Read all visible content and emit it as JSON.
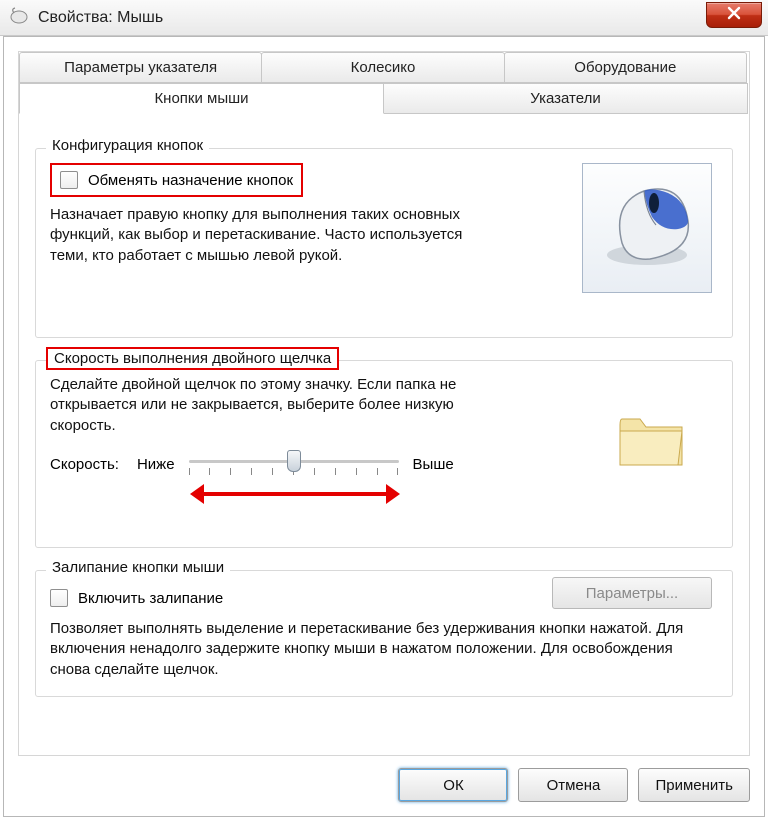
{
  "titlebar": {
    "title": "Свойства: Мышь"
  },
  "tabs": {
    "row1": [
      {
        "label": "Параметры указателя"
      },
      {
        "label": "Колесико"
      },
      {
        "label": "Оборудование"
      }
    ],
    "row2": [
      {
        "label": "Кнопки мыши",
        "active": true
      },
      {
        "label": "Указатели"
      }
    ]
  },
  "group_buttons": {
    "legend": "Конфигурация кнопок",
    "swap_label": "Обменять назначение кнопок",
    "desc": "Назначает правую кнопку для выполнения таких основных функций, как выбор и перетаскивание. Часто используется теми, кто работает с мышью левой рукой."
  },
  "group_dblclick": {
    "legend": "Скорость выполнения двойного щелчка",
    "desc": "Сделайте двойной щелчок по этому значку. Если папка не открывается или не закрывается, выберите более низкую скорость.",
    "speed_label": "Скорость:",
    "low_label": "Ниже",
    "high_label": "Выше"
  },
  "group_clicklock": {
    "legend": "Залипание кнопки мыши",
    "enable_label": "Включить залипание",
    "params_button": "Параметры...",
    "desc": "Позволяет выполнять выделение и перетаскивание без удерживания кнопки нажатой. Для включения ненадолго задержите кнопку мыши в нажатом положении. Для освобождения снова сделайте щелчок."
  },
  "buttons": {
    "ok": "ОК",
    "cancel": "Отмена",
    "apply": "Применить"
  }
}
